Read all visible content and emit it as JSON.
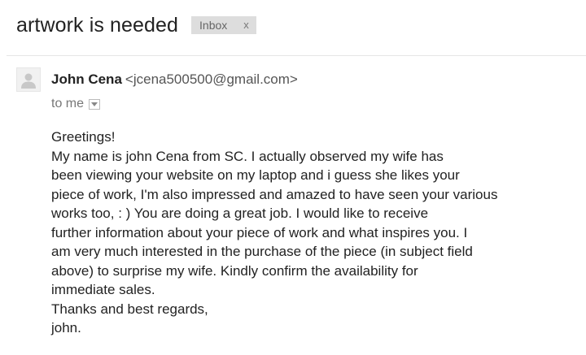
{
  "subject": "artwork is needed",
  "label": {
    "text": "Inbox",
    "remove": "x"
  },
  "sender": {
    "name": "John Cena",
    "email": "<jcena500500@gmail.com>"
  },
  "recipient": "to me",
  "body_lines": [
    "Greetings!",
    "My name is john Cena from SC. I actually observed my wife has",
    "been viewing your website on my laptop and i guess she likes your",
    "piece of work, I'm also impressed and amazed to have seen your various",
    "works too, : )  You are doing a great job. I would like to receive",
    "further information about your piece of work and what inspires you. I",
    "am very much interested in the purchase of the piece (in subject field",
    "above) to surprise my wife. Kindly confirm the availability for",
    "immediate sales.",
    "Thanks and best regards,",
    "john."
  ],
  "icons": {
    "avatar": "person-silhouette-icon",
    "details": "chevron-down-icon"
  },
  "colors": {
    "label_bg": "#dddddd",
    "text": "#222222",
    "muted": "#777777"
  }
}
